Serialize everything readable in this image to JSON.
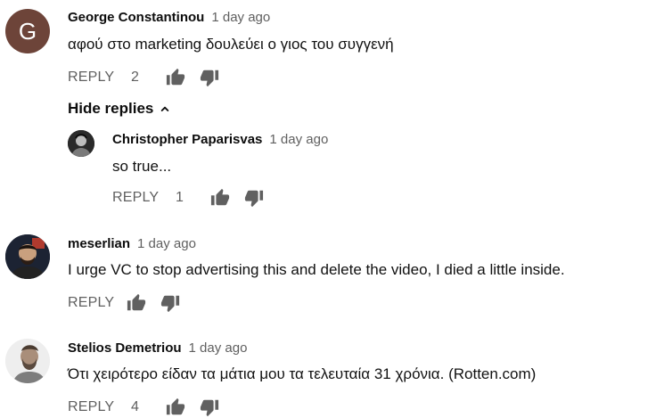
{
  "comments": [
    {
      "avatar_letter": "G",
      "avatar_color": "#6d4439",
      "author": "George Constantinou",
      "time": "1 day ago",
      "text": "αφού στο marketing δουλεύει ο γιος του συγγενή",
      "reply_label": "REPLY",
      "likes": "2"
    },
    {
      "author": "Christopher Paparisvas",
      "time": "1 day ago",
      "text": "so true...",
      "reply_label": "REPLY",
      "likes": "1"
    },
    {
      "author": "meserlian",
      "time": "1 day ago",
      "text": "I urge VC to stop advertising this and delete the video, I died a little inside.",
      "reply_label": "REPLY",
      "likes": ""
    },
    {
      "author": "Stelios Demetriou",
      "time": "1 day ago",
      "text": "Ότι χειρότερο είδαν τα μάτια μου τα τελευταία  31 χρόνια. (Rotten.com)",
      "reply_label": "REPLY",
      "likes": "4"
    }
  ],
  "hide_replies_label": "Hide replies",
  "icons": {
    "like": "thumbs-up-icon",
    "dislike": "thumbs-down-icon",
    "chevron": "chevron-up-icon"
  }
}
